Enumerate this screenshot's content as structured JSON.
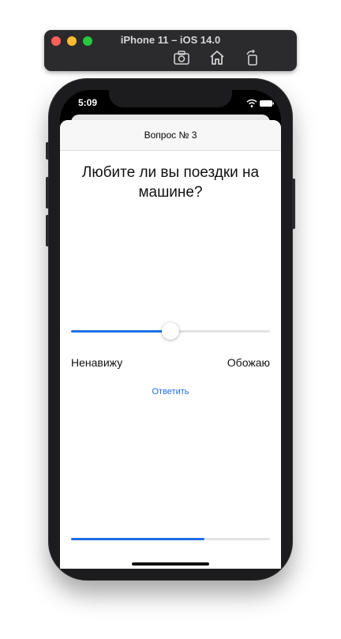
{
  "simulator": {
    "title": "iPhone 11 – iOS 14.0",
    "toolbar": [
      "screenshot-icon",
      "home-icon",
      "rotate-icon"
    ]
  },
  "status_bar": {
    "time": "5:09",
    "icons": [
      "wifi-icon",
      "battery-icon"
    ]
  },
  "nav": {
    "title": "Вопрос № 3"
  },
  "question": {
    "text": "Любите ли вы поездки на машине?"
  },
  "slider": {
    "value": 0.5,
    "min_label": "Ненавижу",
    "max_label": "Обожаю"
  },
  "answer_button": {
    "label": "Ответить"
  },
  "progress": {
    "value": 0.67
  },
  "colors": {
    "accent": "#1d6fe8",
    "track": "#e3e3e3"
  }
}
